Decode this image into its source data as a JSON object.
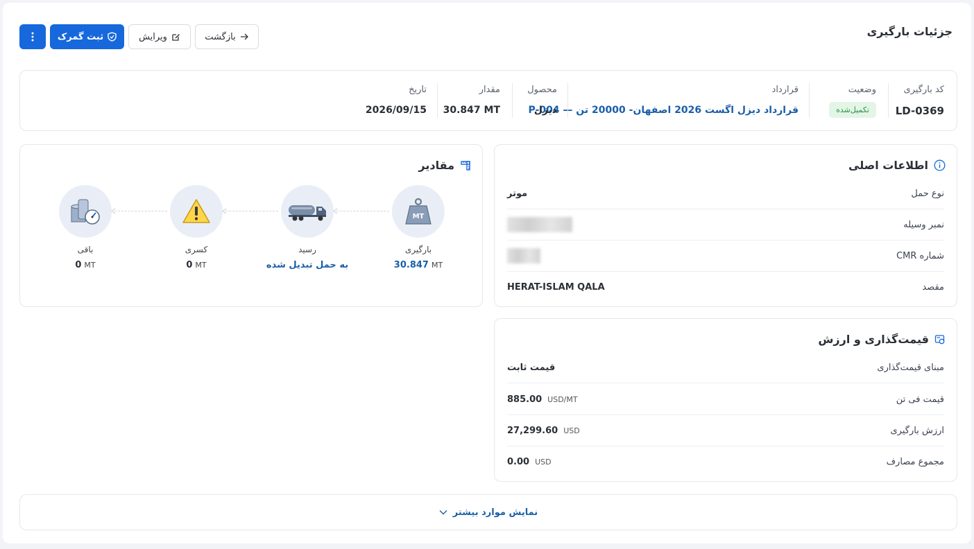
{
  "page_title": "جزئیات بارگیری",
  "actions": {
    "back": "بازگشت",
    "edit": "ویرایش",
    "customs": "ثبت گمرک"
  },
  "summary": {
    "code": {
      "label": "کد بارگیری",
      "value": "LD-0369"
    },
    "status": {
      "label": "وضعیت",
      "value": "تکمیل‌شده"
    },
    "contract": {
      "label": "قرارداد",
      "value": "قرارداد دیزل اگست 2026 اصفهان- 20000 تن — P-004"
    },
    "product": {
      "label": "محصول",
      "value": "دیزل"
    },
    "amount": {
      "label": "مقدار",
      "value": "30.847 MT"
    },
    "date": {
      "label": "تاریخ",
      "value": "2026/09/15"
    }
  },
  "main_info": {
    "title": "اطلاعات اصلی",
    "rows": [
      {
        "label": "نوع حمل",
        "value": "موتر"
      },
      {
        "label": "نمبر وسیله",
        "value": ""
      },
      {
        "label": "شماره CMR",
        "value": ""
      },
      {
        "label": "مقصد",
        "value": "HERAT-ISLAM QALA"
      }
    ]
  },
  "pricing": {
    "title": "قیمت‌گذاری و ارزش",
    "rows": [
      {
        "label": "مبنای قیمت‌گذاری",
        "value": "قیمت ثابت",
        "unit": ""
      },
      {
        "label": "قیمت فی تن",
        "value": "885.00",
        "unit": "USD/MT"
      },
      {
        "label": "ارزش بارگیری",
        "value": "27,299.60",
        "unit": "USD"
      },
      {
        "label": "مجموع مصارف",
        "value": "0.00",
        "unit": "USD"
      }
    ]
  },
  "quantities": {
    "title": "مقادیر",
    "loaded": {
      "label": "بارگیری",
      "value": "30.847",
      "unit": "MT"
    },
    "received": {
      "label": "رسید",
      "value": "به حمل تبدیل شده"
    },
    "shortage": {
      "label": "کسری",
      "value": "0",
      "unit": "MT"
    },
    "remaining": {
      "label": "باقی",
      "value": "0",
      "unit": "MT"
    }
  },
  "show_more": "نمایش موارد بیشتر",
  "colors": {
    "primary": "#1668dc",
    "link": "#1a5fa8",
    "success_bg": "#e3f5e6",
    "success_text": "#2f9344"
  }
}
